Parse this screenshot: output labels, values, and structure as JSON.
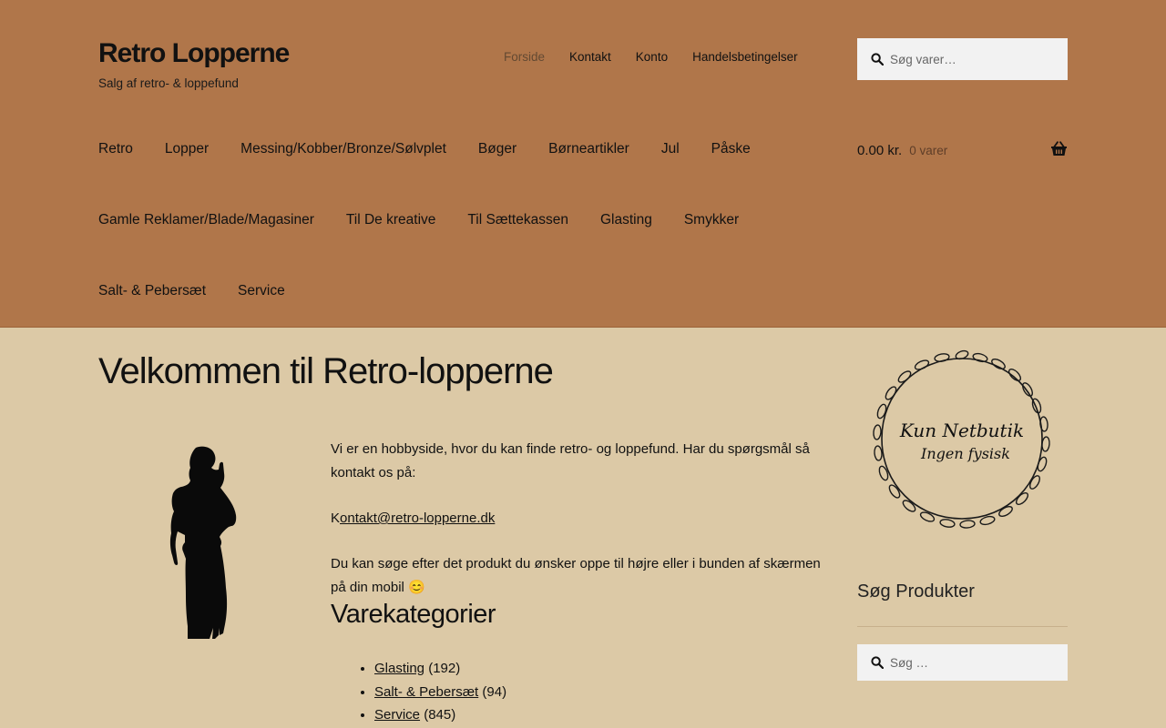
{
  "site": {
    "title": "Retro Lopperne",
    "tagline": "Salg af retro- & loppefund"
  },
  "secondary_nav": [
    "Forside",
    "Kontakt",
    "Konto",
    "Handelsbetingelser"
  ],
  "header_search": {
    "placeholder": "Søg varer…"
  },
  "main_nav": {
    "row1": [
      "Retro",
      "Lopper",
      "Messing/Kobber/Bronze/Sølvplet",
      "Bøger",
      "Børneartikler",
      "Jul",
      "Påske"
    ],
    "row2": [
      "Gamle Reklamer/Blade/Magasiner",
      "Til De kreative",
      "Til Sættekassen",
      "Glasting",
      "Smykker"
    ],
    "row3": [
      "Salt- & Pebersæt",
      "Service"
    ]
  },
  "cart": {
    "amount": "0.00 kr.",
    "count": "0 varer"
  },
  "page": {
    "title": "Velkommen til Retro-lopperne",
    "intro": "Vi er en hobbyside, hvor du kan finde retro- og loppefund. Har du spørgsmål så kontakt os på:",
    "email_prefix": "K",
    "email_link": "ontakt@retro-lopperne.dk",
    "search_hint": "Du kan søge efter det produkt du ønsker oppe til højre eller i bunden af skærmen på din mobil 😊",
    "categories_heading": "Varekategorier",
    "categories": [
      {
        "name": "Glasting",
        "count": "(192)"
      },
      {
        "name": "Salt- & Pebersæt",
        "count": "(94)"
      },
      {
        "name": "Service",
        "count": "(845)"
      }
    ]
  },
  "sidebar": {
    "badge_line1": "Kun Netbutik",
    "badge_line2": "Ingen fysisk",
    "widget_title": "Søg Produkter",
    "search_placeholder": "Søg …"
  },
  "colors": {
    "header_bg": "#b0764a",
    "page_bg": "#dcc9a6",
    "search_bg": "#f2f2f2"
  }
}
